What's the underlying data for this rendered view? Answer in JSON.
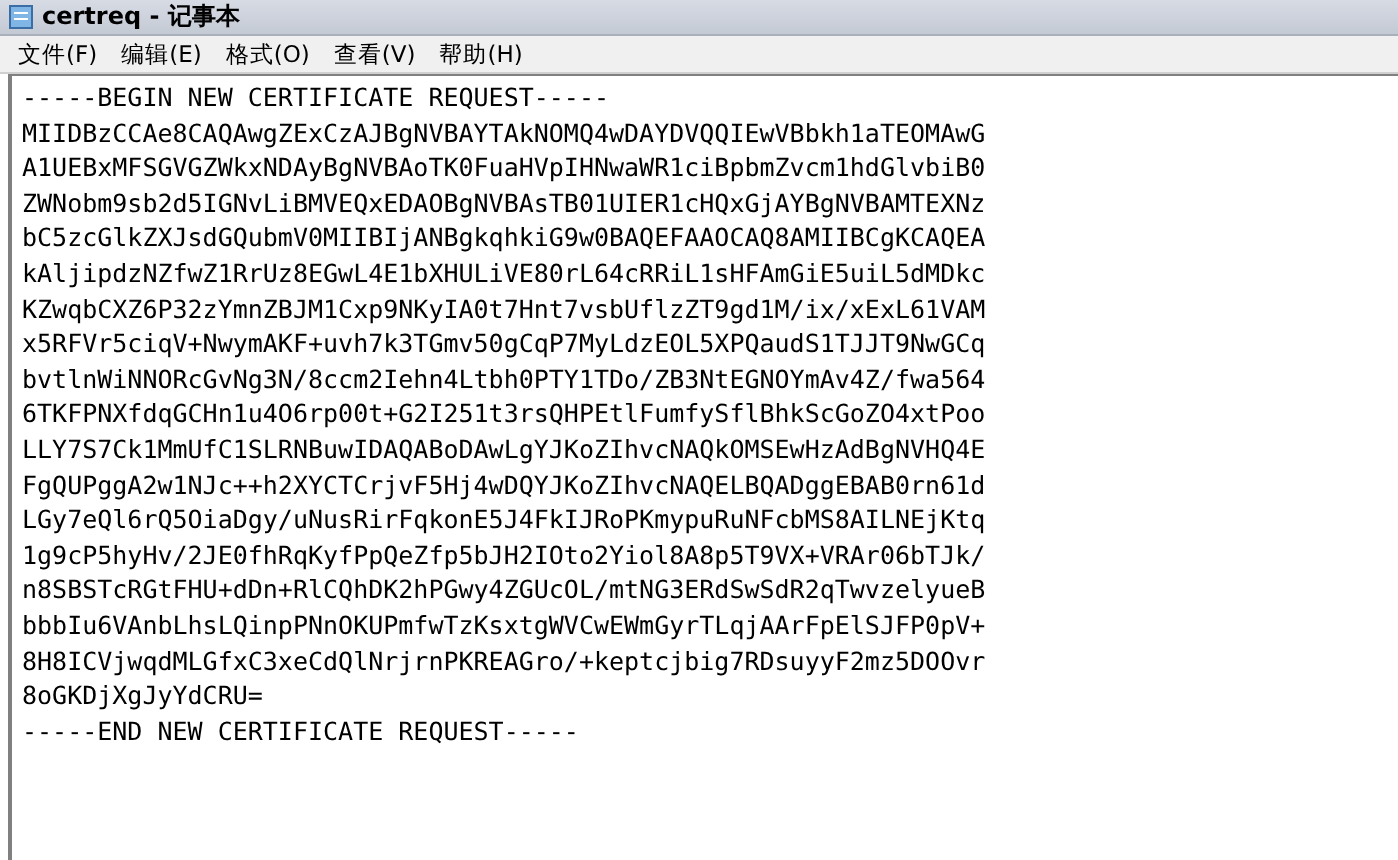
{
  "window": {
    "title": "certreq - 记事本"
  },
  "menu": [
    {
      "label": "文件(F)"
    },
    {
      "label": "编辑(E)"
    },
    {
      "label": "格式(O)"
    },
    {
      "label": "查看(V)"
    },
    {
      "label": "帮助(H)"
    }
  ],
  "document": {
    "lines": [
      "-----BEGIN NEW CERTIFICATE REQUEST-----",
      "MIIDBzCCAe8CAQAwgZExCzAJBgNVBAYTAkNOMQ4wDAYDVQQIEwVBbkh1aTEOMAwG",
      "A1UEBxMFSGVGZWkxNDAyBgNVBAoTK0FuaHVpIHNwaWR1ciBpbmZvcm1hdGlvbiB0",
      "ZWNobm9sb2d5IGNvLiBMVEQxEDAOBgNVBAsTB01UIER1cHQxGjAYBgNVBAMTEXNz",
      "bC5zcGlkZXJsdGQubmV0MIIBIjANBgkqhkiG9w0BAQEFAAOCAQ8AMIIBCgKCAQEA",
      "kAljipdzNZfwZ1RrUz8EGwL4E1bXHULiVE80rL64cRRiL1sHFAmGiE5uiL5dMDkc",
      "KZwqbCXZ6P32zYmnZBJM1Cxp9NKyIA0t7Hnt7vsbUflzZT9gd1M/ix/xExL61VAM",
      "x5RFVr5ciqV+NwymAKF+uvh7k3TGmv50gCqP7MyLdzEOL5XPQaudS1TJJT9NwGCq",
      "bvtlnWiNNORcGvNg3N/8ccm2Iehn4Ltbh0PTY1TDo/ZB3NtEGNOYmAv4Z/fwa564",
      "6TKFPNXfdqGCHn1u4O6rp00t+G2I251t3rsQHPEtlFumfySflBhkScGoZO4xtPoo",
      "LLY7S7Ck1MmUfC1SLRNBuwIDAQABoDAwLgYJKoZIhvcNAQkOMSEwHzAdBgNVHQ4E",
      "FgQUPggA2w1NJc++h2XYCTCrjvF5Hj4wDQYJKoZIhvcNAQELBQADggEBAB0rn61d",
      "LGy7eQl6rQ5OiaDgy/uNusRirFqkonE5J4FkIJRoPKmypuRuNFcbMS8AILNEjKtq",
      "1g9cP5hyHv/2JE0fhRqKyfPpQeZfp5bJH2IOto2Yiol8A8p5T9VX+VRAr06bTJk/",
      "n8SBSTcRGtFHU+dDn+RlCQhDK2hPGwy4ZGUcOL/mtNG3ERdSwSdR2qTwvzelyueB",
      "bbbIu6VAnbLhsLQinpPNnOKUPmfwTzKsxtgWVCwEWmGyrTLqjAArFpElSJFP0pV+",
      "8H8ICVjwqdMLGfxC3xeCdQlNrjrnPKREAGro/+keptcjbig7RDsuyyF2mz5DOOvr",
      "8oGKDjXgJyYdCRU=",
      "-----END NEW CERTIFICATE REQUEST-----"
    ]
  }
}
